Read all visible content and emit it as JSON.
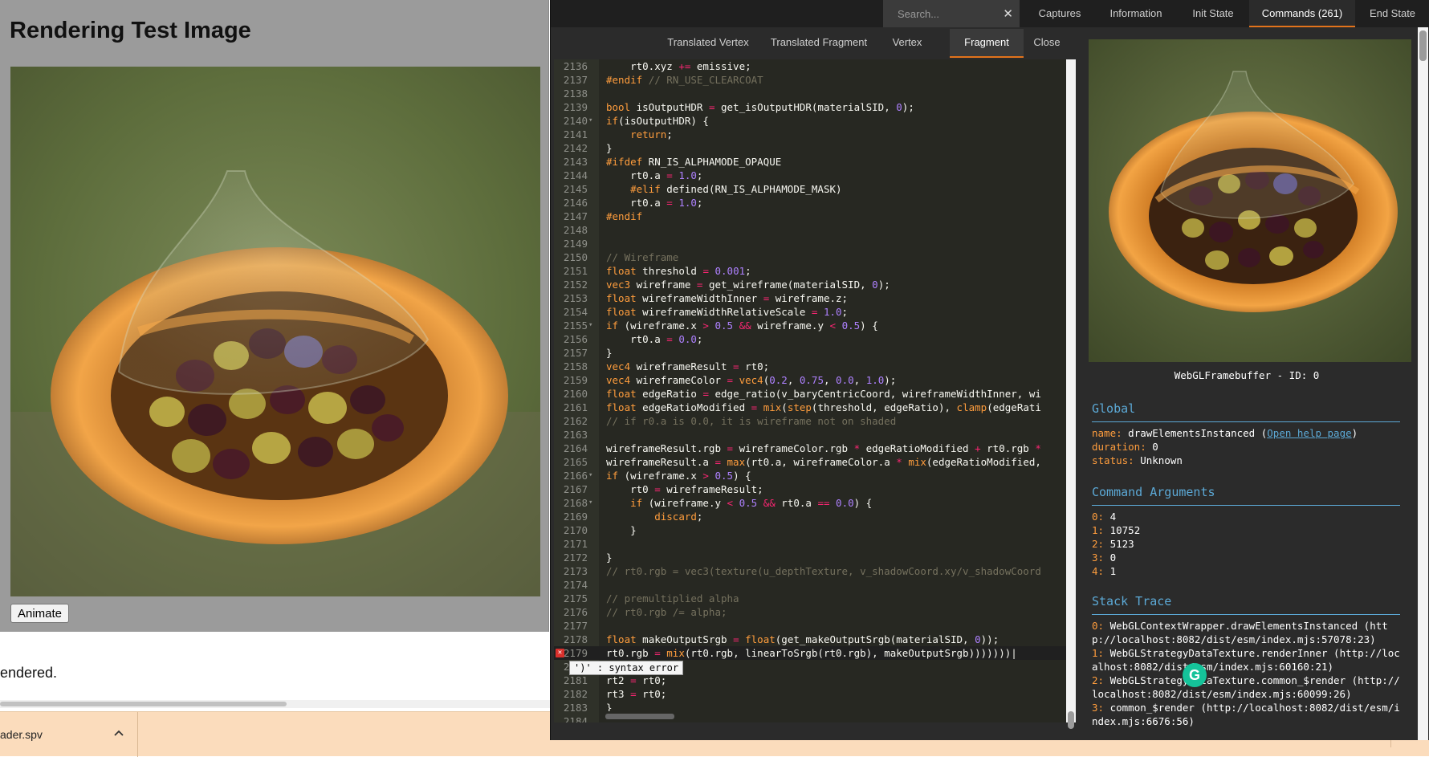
{
  "left_page": {
    "title": "Rendering Test Image",
    "animate_label": "Animate",
    "rendered_text": "endered."
  },
  "download_bar": {
    "file_name": "ader.spv",
    "chevron_icon": "chevron-up-icon"
  },
  "inspector": {
    "search": {
      "placeholder": "Search...",
      "clear_icon": "close-icon"
    },
    "top_tabs": [
      "Captures",
      "Information",
      "Init State",
      "Commands (261)",
      "End State"
    ],
    "active_top_tab": "Commands (261)",
    "sub_tabs": [
      "Translated Vertex",
      "Translated Fragment",
      "Vertex",
      "Fragment",
      "Close"
    ],
    "active_sub_tab": "Fragment",
    "error_message": "')' : syntax error",
    "framebuffer_caption": "WebGLFramebuffer - ID: 0",
    "global": {
      "title": "Global",
      "name_key": "name:",
      "name_value": "drawElementsInstanced (",
      "help_link": "Open help page",
      "name_close": ")",
      "duration_key": "duration:",
      "duration_value": "0",
      "status_key": "status:",
      "status_value": "Unknown"
    },
    "command_arguments": {
      "title": "Command Arguments",
      "items": [
        {
          "key": "0:",
          "value": "4"
        },
        {
          "key": "1:",
          "value": "10752"
        },
        {
          "key": "2:",
          "value": "5123"
        },
        {
          "key": "3:",
          "value": "0"
        },
        {
          "key": "4:",
          "value": "1"
        }
      ]
    },
    "stack_trace": {
      "title": "Stack Trace",
      "items": [
        {
          "key": "0:",
          "value": "WebGLContextWrapper.drawElementsInstanced (http://localhost:8082/dist/esm/index.mjs:57078:23)"
        },
        {
          "key": "1:",
          "value": "WebGLStrategyDataTexture.renderInner (http://localhost:8082/dist/esm/index.mjs:60160:21)"
        },
        {
          "key": "2:",
          "value": "WebGLStrategyDataTexture.common_$render (http://localhost:8082/dist/esm/index.mjs:60099:26)"
        },
        {
          "key": "3:",
          "value": "common_$render (http://localhost:8082/dist/esm/index.mjs:6676:56)"
        }
      ]
    }
  },
  "code_lines": [
    {
      "n": "2136",
      "html": "    rt0.xyz <span class='r'>+=</span> emissive;"
    },
    {
      "n": "2137",
      "html": "<span class='pp'>#endif</span> <span class='c'>// RN_USE_CLEARCOAT</span>"
    },
    {
      "n": "2138",
      "html": ""
    },
    {
      "n": "2139",
      "html": "<span class='pp'>bool</span> isOutputHDR <span class='r'>=</span> get_isOutputHDR(materialSID, <span class='n'>0</span>);"
    },
    {
      "n": "2140",
      "fold": true,
      "html": "<span class='pp'>if</span>(isOutputHDR) {"
    },
    {
      "n": "2141",
      "html": "    <span class='pp'>return</span>;"
    },
    {
      "n": "2142",
      "html": "}"
    },
    {
      "n": "2143",
      "html": "<span class='pp'>#ifdef</span> RN_IS_ALPHAMODE_OPAQUE"
    },
    {
      "n": "2144",
      "html": "    rt0.a <span class='r'>=</span> <span class='n'>1.0</span>;"
    },
    {
      "n": "2145",
      "html": "    <span class='pp'>#elif</span> defined(RN_IS_ALPHAMODE_MASK)"
    },
    {
      "n": "2146",
      "html": "    rt0.a <span class='r'>=</span> <span class='n'>1.0</span>;"
    },
    {
      "n": "2147",
      "html": "<span class='pp'>#endif</span>"
    },
    {
      "n": "2148",
      "html": ""
    },
    {
      "n": "2149",
      "html": ""
    },
    {
      "n": "2150",
      "html": "<span class='c'>// Wireframe</span>"
    },
    {
      "n": "2151",
      "html": "<span class='pp'>float</span> threshold <span class='r'>=</span> <span class='n'>0.001</span>;"
    },
    {
      "n": "2152",
      "html": "<span class='pp'>vec3</span> wireframe <span class='r'>=</span> get_wireframe(materialSID, <span class='n'>0</span>);"
    },
    {
      "n": "2153",
      "html": "<span class='pp'>float</span> wireframeWidthInner <span class='r'>=</span> wireframe.z;"
    },
    {
      "n": "2154",
      "html": "<span class='pp'>float</span> wireframeWidthRelativeScale <span class='r'>=</span> <span class='n'>1.0</span>;"
    },
    {
      "n": "2155",
      "fold": true,
      "html": "<span class='pp'>if</span> (wireframe.x <span class='r'>&gt;</span> <span class='n'>0.5</span> <span class='r'>&amp;&amp;</span> wireframe.y <span class='r'>&lt;</span> <span class='n'>0.5</span>) {"
    },
    {
      "n": "2156",
      "html": "    rt0.a <span class='r'>=</span> <span class='n'>0.0</span>;"
    },
    {
      "n": "2157",
      "html": "}"
    },
    {
      "n": "2158",
      "html": "<span class='pp'>vec4</span> wireframeResult <span class='r'>=</span> rt0;"
    },
    {
      "n": "2159",
      "html": "<span class='pp'>vec4</span> wireframeColor <span class='r'>=</span> <span class='pp'>vec4</span>(<span class='n'>0.2</span>, <span class='n'>0.75</span>, <span class='n'>0.0</span>, <span class='n'>1.0</span>);"
    },
    {
      "n": "2160",
      "html": "<span class='pp'>float</span> edgeRatio <span class='r'>=</span> edge_ratio(v_baryCentricCoord, wireframeWidthInner, wi"
    },
    {
      "n": "2161",
      "html": "<span class='pp'>float</span> edgeRatioModified <span class='r'>=</span> <span class='pp'>mix</span>(<span class='pp'>step</span>(threshold, edgeRatio), <span class='pp'>clamp</span>(edgeRati"
    },
    {
      "n": "2162",
      "html": "<span class='c'>// if r0.a is 0.0, it is wireframe not on shaded</span>"
    },
    {
      "n": "2163",
      "html": ""
    },
    {
      "n": "2164",
      "html": "wireframeResult.rgb <span class='r'>=</span> wireframeColor.rgb <span class='r'>*</span> edgeRatioModified <span class='r'>+</span> rt0.rgb <span class='r'>*</span>"
    },
    {
      "n": "2165",
      "html": "wireframeResult.a <span class='r'>=</span> <span class='pp'>max</span>(rt0.a, wireframeColor.a <span class='r'>*</span> <span class='pp'>mix</span>(edgeRatioModified,"
    },
    {
      "n": "2166",
      "fold": true,
      "html": "<span class='pp'>if</span> (wireframe.x <span class='r'>&gt;</span> <span class='n'>0.5</span>) {"
    },
    {
      "n": "2167",
      "html": "    rt0 <span class='r'>=</span> wireframeResult;"
    },
    {
      "n": "2168",
      "fold": true,
      "html": "    <span class='pp'>if</span> (wireframe.y <span class='r'>&lt;</span> <span class='n'>0.5</span> <span class='r'>&amp;&amp;</span> rt0.a <span class='r'>==</span> <span class='n'>0.0</span>) {"
    },
    {
      "n": "2169",
      "html": "        <span class='pp'>discard</span>;"
    },
    {
      "n": "2170",
      "html": "    }"
    },
    {
      "n": "2171",
      "html": ""
    },
    {
      "n": "2172",
      "html": "}"
    },
    {
      "n": "2173",
      "html": "<span class='c'>// rt0.rgb = vec3(texture(u_depthTexture, v_shadowCoord.xy/v_shadowCoord</span>"
    },
    {
      "n": "2174",
      "html": ""
    },
    {
      "n": "2175",
      "html": "<span class='c'>// premultiplied alpha</span>"
    },
    {
      "n": "2176",
      "html": "<span class='c'>// rt0.rgb /= alpha;</span>"
    },
    {
      "n": "2177",
      "html": ""
    },
    {
      "n": "2178",
      "html": "<span class='pp'>float</span> makeOutputSrgb <span class='r'>=</span> <span class='pp'>float</span>(get_makeOutputSrgb(materialSID, <span class='n'>0</span>));"
    },
    {
      "n": "2179",
      "error": true,
      "html": "rt0.rgb <span class='r'>=</span> <span class='pp'>mix</span>(rt0.rgb, linearToSrgb(rt0.rgb), makeOutputSrgb)))))))|"
    },
    {
      "n": "2180",
      "html": ""
    },
    {
      "n": "2181",
      "html": "rt2 <span class='r'>=</span> rt0;"
    },
    {
      "n": "2182",
      "html": "rt3 <span class='r'>=</span> rt0;"
    },
    {
      "n": "2183",
      "html": "}"
    },
    {
      "n": "2184",
      "html": ""
    }
  ],
  "colors": {
    "accent": "#e2731b",
    "link": "#5ca9d6",
    "key": "#ff9d3d",
    "error": "#d9302c"
  }
}
